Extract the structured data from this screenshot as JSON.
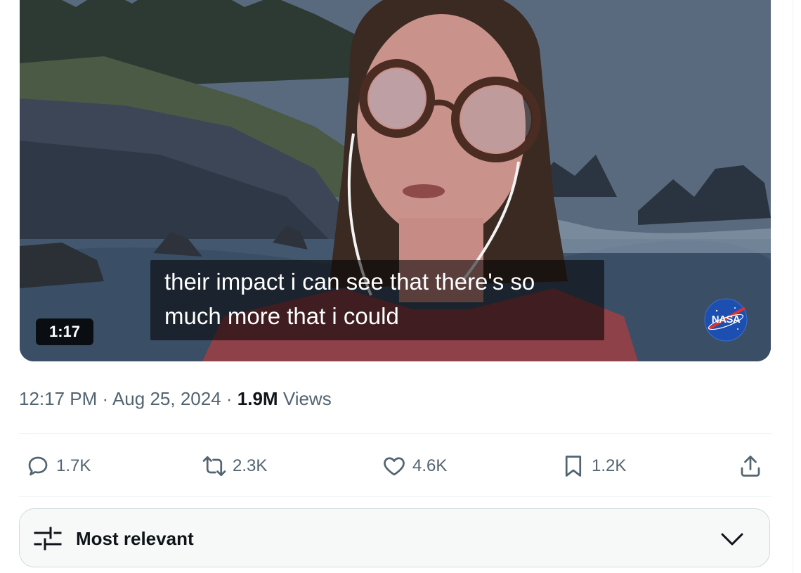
{
  "video": {
    "caption_line1": "their impact i can see that there's so",
    "caption_line2": "much more that i could",
    "duration": "1:17",
    "watermark": "NASA"
  },
  "tweet_meta": {
    "time": "12:17 PM",
    "date": "Aug 25, 2024",
    "separator": " · ",
    "views_count": "1.9M",
    "views_label": "Views"
  },
  "actions": {
    "replies": "1.7K",
    "reposts": "2.3K",
    "likes": "4.6K",
    "bookmarks": "1.2K"
  },
  "sort": {
    "label": "Most relevant"
  },
  "icons": {
    "reply": "reply-icon",
    "repost": "repost-icon",
    "like": "heart-icon",
    "bookmark": "bookmark-icon",
    "share": "share-icon",
    "sort": "sliders-icon",
    "dropdown": "chevron-down-icon"
  },
  "colors": {
    "text_primary": "#0f1419",
    "text_secondary": "#536471",
    "border": "#cfd9de"
  }
}
